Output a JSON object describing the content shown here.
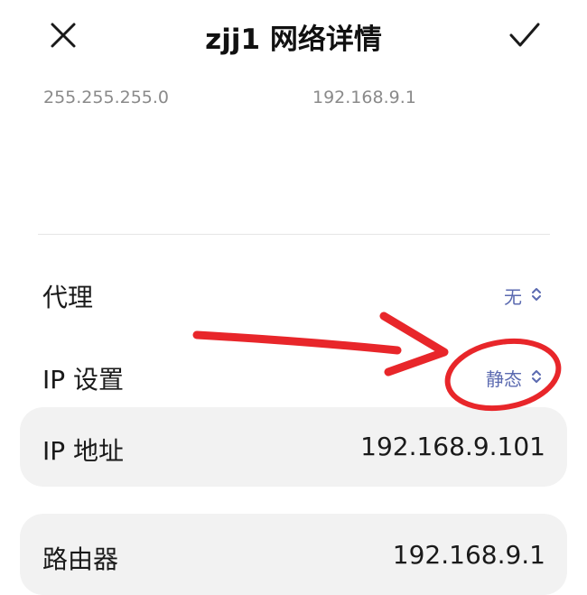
{
  "header": {
    "title": "zjj1 网络详情",
    "close_icon": "close-icon",
    "confirm_icon": "check-icon"
  },
  "ip_info": {
    "subnet_mask": "255.255.255.0",
    "gateway": "192.168.9.1"
  },
  "proxy": {
    "label": "代理",
    "value": "无"
  },
  "ip_settings": {
    "label": "IP 设置",
    "value": "静态"
  },
  "ip_address": {
    "label": "IP 地址",
    "value": "192.168.9.101"
  },
  "router": {
    "label": "路由器",
    "value": "192.168.9.1"
  },
  "colors": {
    "accent": "#5b6ab0",
    "annotation": "#e8262a",
    "card_bg": "#f2f2f2"
  }
}
